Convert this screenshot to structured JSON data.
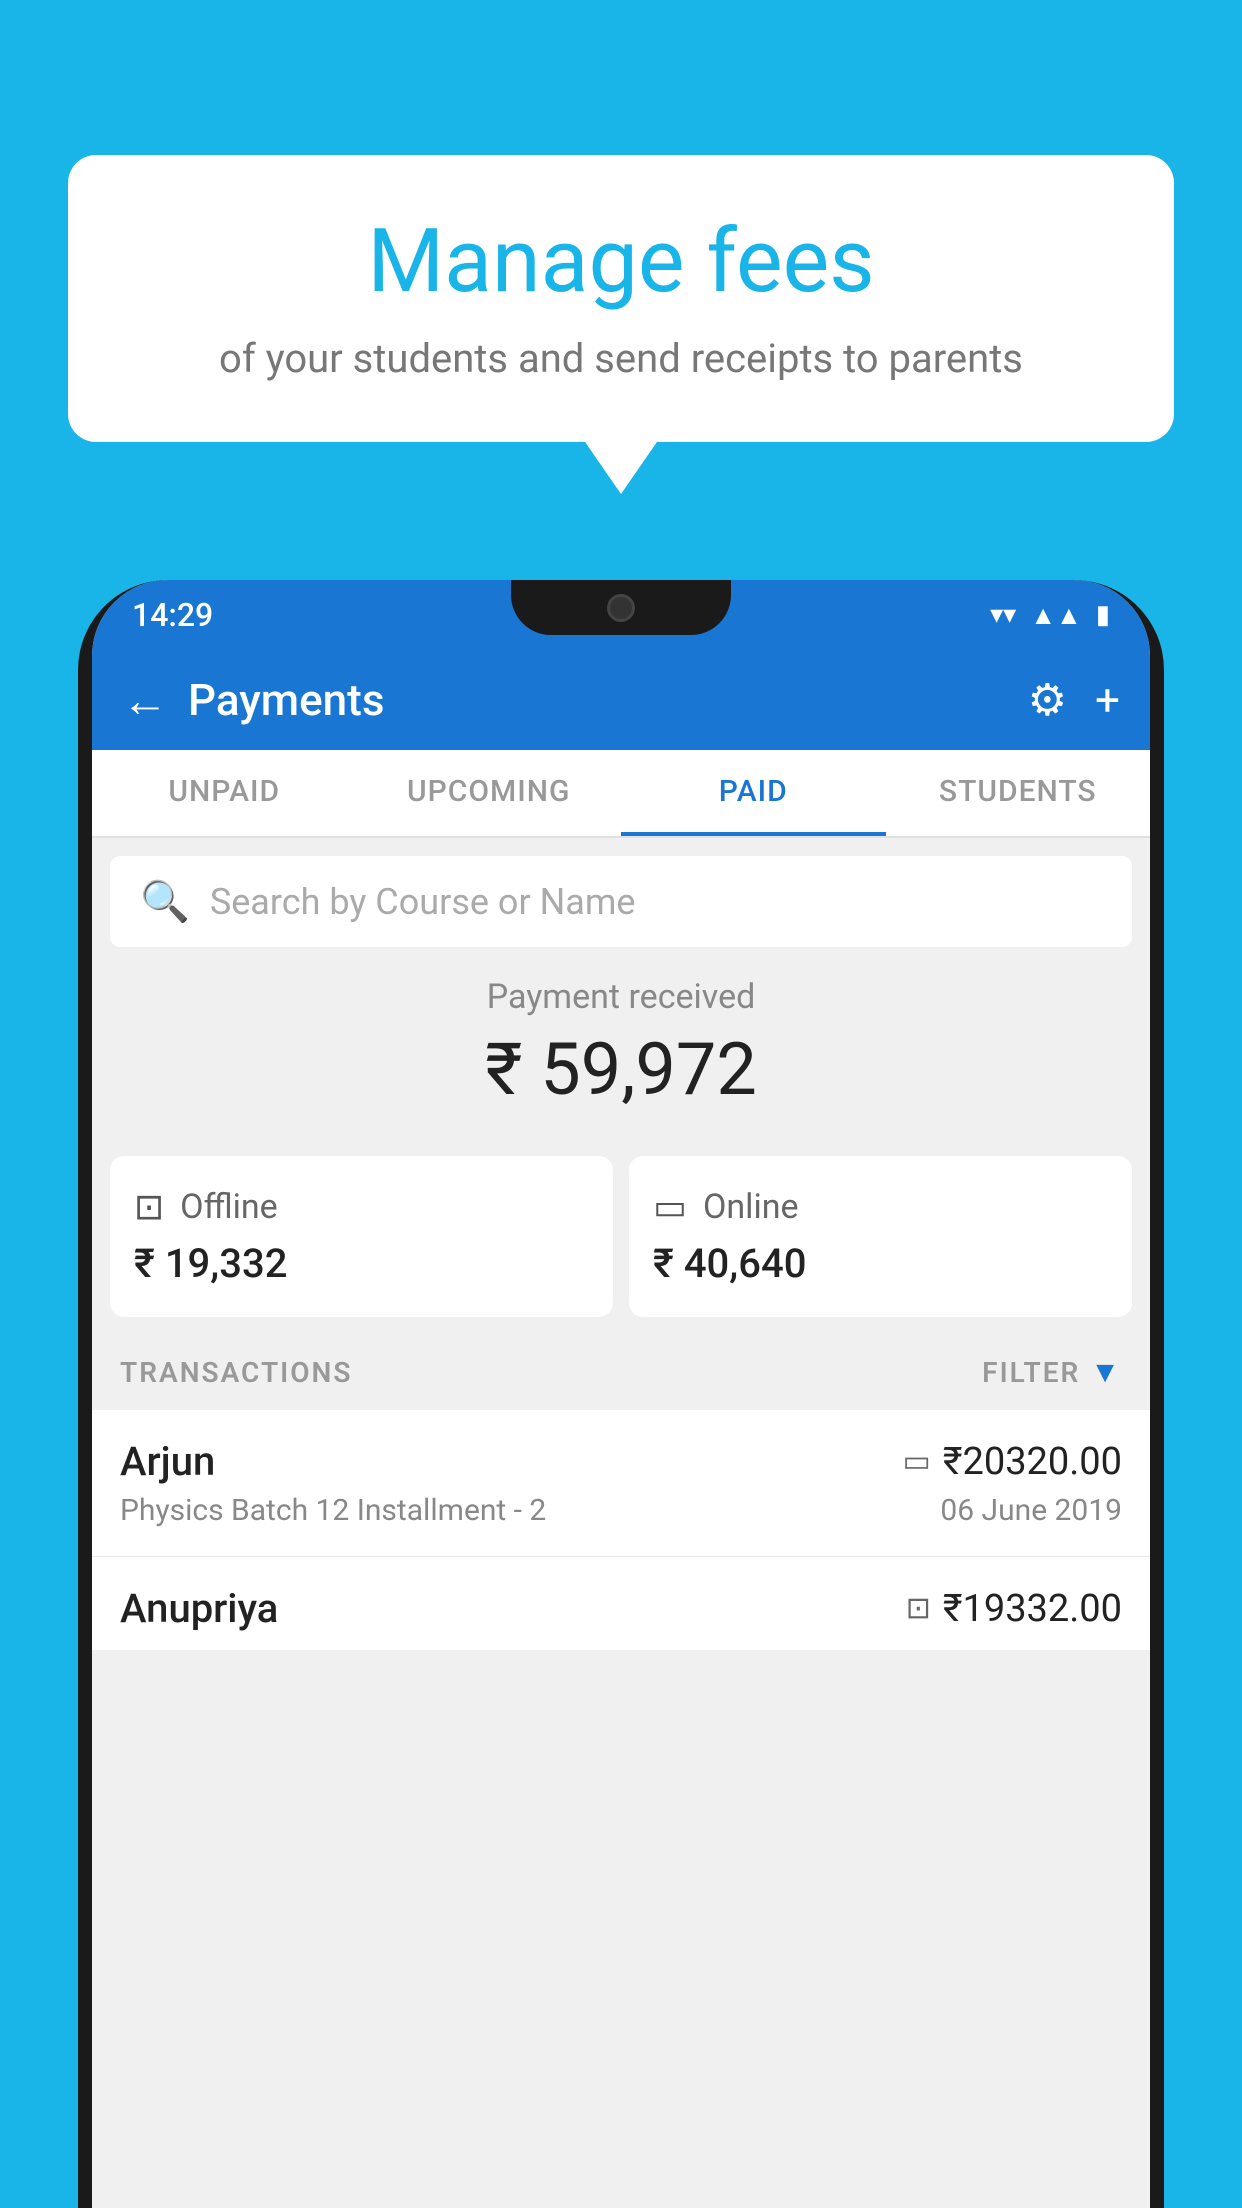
{
  "background_color": "#1ab5e8",
  "speech_bubble": {
    "title": "Manage fees",
    "subtitle": "of your students and send receipts to parents"
  },
  "status_bar": {
    "time": "14:29",
    "wifi": "▼",
    "signal": "▲",
    "battery": "▮"
  },
  "app_bar": {
    "title": "Payments",
    "back_icon": "←",
    "settings_icon": "⚙",
    "add_icon": "+"
  },
  "tabs": [
    {
      "label": "UNPAID",
      "active": false
    },
    {
      "label": "UPCOMING",
      "active": false
    },
    {
      "label": "PAID",
      "active": true
    },
    {
      "label": "STUDENTS",
      "active": false
    }
  ],
  "search": {
    "placeholder": "Search by Course or Name"
  },
  "payment": {
    "received_label": "Payment received",
    "total_amount": "₹ 59,972",
    "offline": {
      "label": "Offline",
      "amount": "₹ 19,332"
    },
    "online": {
      "label": "Online",
      "amount": "₹ 40,640"
    }
  },
  "transactions": {
    "section_label": "TRANSACTIONS",
    "filter_label": "FILTER",
    "rows": [
      {
        "name": "Arjun",
        "amount": "₹20320.00",
        "type_icon": "card",
        "description": "Physics Batch 12 Installment - 2",
        "date": "06 June 2019"
      },
      {
        "name": "Anupriya",
        "amount": "₹19332.00",
        "type_icon": "cash",
        "description": "",
        "date": ""
      }
    ]
  }
}
